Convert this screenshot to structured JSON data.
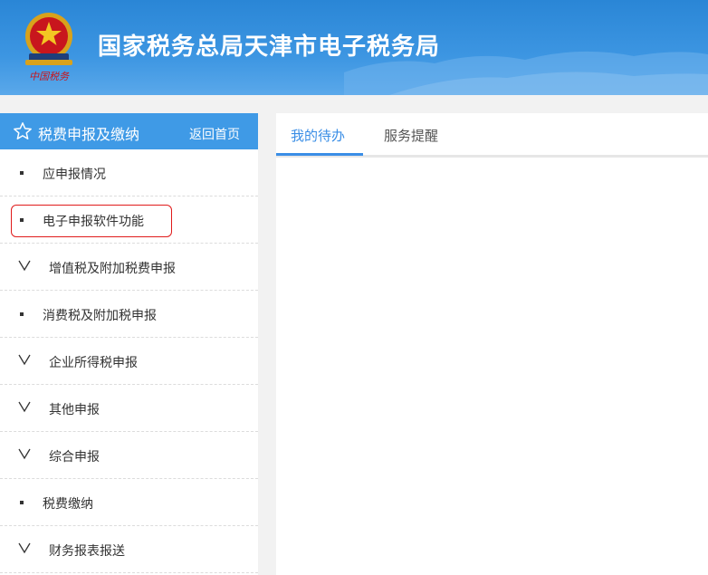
{
  "header": {
    "title": "国家税务总局天津市电子税务局",
    "logo_text": "中国税务"
  },
  "sidebar": {
    "title": "税费申报及缴纳",
    "home_link": "返回首页",
    "items": [
      {
        "label": "应申报情况",
        "type": "dot"
      },
      {
        "label": "电子申报软件功能",
        "type": "dot",
        "highlighted": true
      },
      {
        "label": "增值税及附加税费申报",
        "type": "expand"
      },
      {
        "label": "消费税及附加税申报",
        "type": "dot"
      },
      {
        "label": "企业所得税申报",
        "type": "expand"
      },
      {
        "label": "其他申报",
        "type": "expand"
      },
      {
        "label": "综合申报",
        "type": "expand"
      },
      {
        "label": "税费缴纳",
        "type": "dot"
      },
      {
        "label": "财务报表报送",
        "type": "expand"
      }
    ]
  },
  "tabs": [
    {
      "label": "我的待办",
      "active": true
    },
    {
      "label": "服务提醒",
      "active": false
    }
  ],
  "colors": {
    "header_blue": "#2a86d6",
    "sidebar_head": "#3f9ae6",
    "active_tab": "#3a8ee6",
    "highlight_red": "#e01b1b"
  }
}
